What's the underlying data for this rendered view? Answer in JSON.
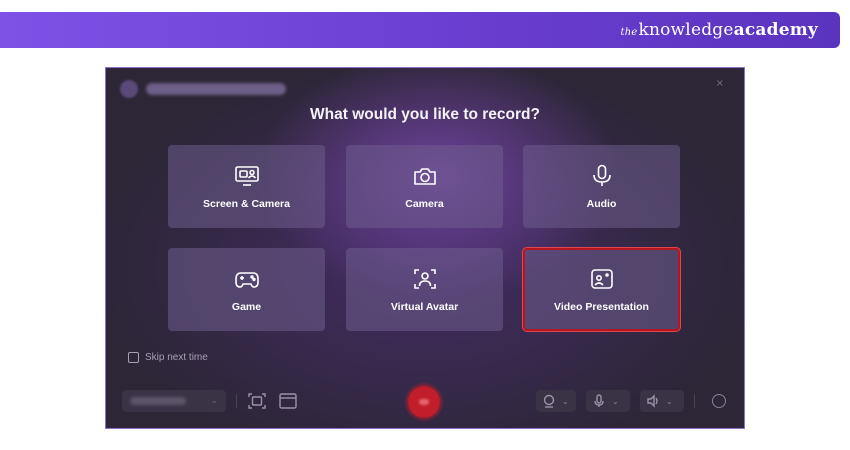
{
  "brand": {
    "prefix": "the",
    "word1": "knowledge",
    "word2": "academy"
  },
  "window": {
    "heading": "What would you like to record?",
    "close_glyph": "×",
    "options": [
      {
        "label": "Screen & Camera",
        "icon": "screen-camera-icon",
        "selected": false
      },
      {
        "label": "Camera",
        "icon": "camera-icon",
        "selected": false
      },
      {
        "label": "Audio",
        "icon": "microphone-icon",
        "selected": false
      },
      {
        "label": "Game",
        "icon": "gamepad-icon",
        "selected": false
      },
      {
        "label": "Virtual Avatar",
        "icon": "avatar-icon",
        "selected": false
      },
      {
        "label": "Video Presentation",
        "icon": "presentation-icon",
        "selected": true
      }
    ],
    "skip_label": "Skip next time",
    "bottom": {
      "chevron": "⌄"
    },
    "colors": {
      "selected_border": "#b3161f",
      "record_button": "#c21d2a"
    }
  }
}
